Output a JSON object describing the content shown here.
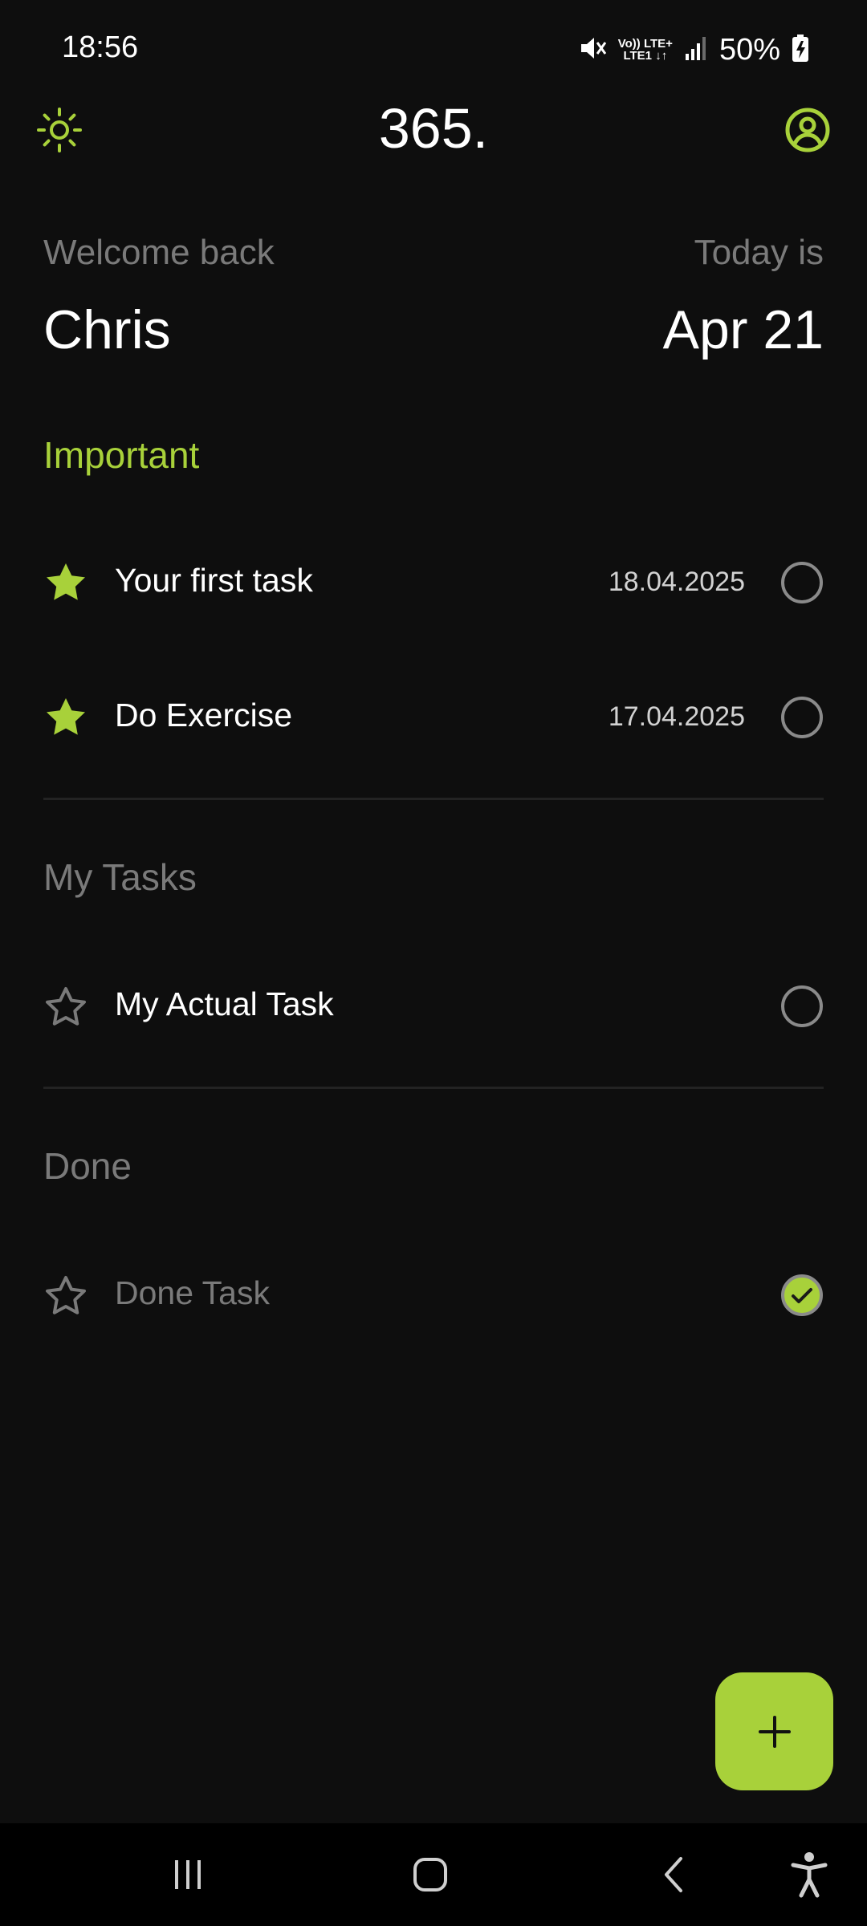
{
  "status_bar": {
    "time": "18:56",
    "network_label_top": "Vo)) LTE+",
    "network_label_bottom": "LTE1 ↓↑",
    "battery": "50%",
    "icons": [
      "mute-icon",
      "signal-icon",
      "battery-charging-icon"
    ]
  },
  "app_bar": {
    "title": "365.",
    "left_icon": "sun-icon",
    "right_icon": "profile-icon"
  },
  "greeting": {
    "welcome_label": "Welcome back",
    "user_name": "Chris",
    "today_label": "Today is",
    "date": "Apr 21"
  },
  "sections": {
    "important": {
      "title": "Important",
      "tasks": [
        {
          "title": "Your first task",
          "date": "18.04.2025",
          "starred": true,
          "done": false
        },
        {
          "title": "Do Exercise",
          "date": "17.04.2025",
          "starred": true,
          "done": false
        }
      ]
    },
    "my_tasks": {
      "title": "My Tasks",
      "tasks": [
        {
          "title": "My Actual Task",
          "date": "",
          "starred": false,
          "done": false
        }
      ]
    },
    "done": {
      "title": "Done",
      "tasks": [
        {
          "title": "Done Task",
          "date": "",
          "starred": false,
          "done": true
        }
      ]
    }
  },
  "fab": {
    "icon": "plus-icon"
  },
  "colors": {
    "accent": "#a8d13a",
    "background": "#0e0e0e",
    "muted_text": "#7a7a7a",
    "divider": "#232323"
  }
}
